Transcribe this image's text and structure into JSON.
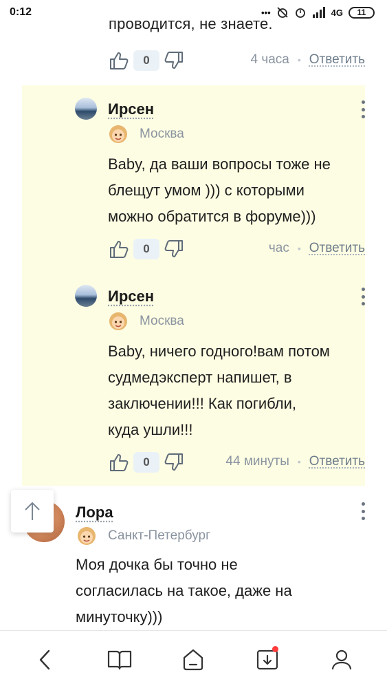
{
  "status_bar": {
    "time": "0:12",
    "network": "4G",
    "battery": "11"
  },
  "top_comment": {
    "partial_text": "проводится, не знаете.",
    "votes": "0",
    "time": "4 часа",
    "reply_label": "Ответить"
  },
  "replies": [
    {
      "author": "Ирсен",
      "city": "Москва",
      "lines": [
        "Baby, да ваши вопросы тоже не",
        "блещут умом ))) с которыми",
        "можно обратится в форуме)))"
      ],
      "votes": "0",
      "time": "час",
      "reply_label": "Ответить"
    },
    {
      "author": "Ирсен",
      "city": "Москва",
      "lines": [
        "Baby, ничего годного!вам потом",
        "судмедэксперт напишет, в",
        "заключении!!! Как погибли,",
        "куда ушли!!!"
      ],
      "votes": "0",
      "time": "44 минуты",
      "reply_label": "Ответить"
    }
  ],
  "lora_comment": {
    "author": "Лора",
    "city": "Санкт-Петербург",
    "lines": [
      "Моя дочка бы точно не",
      "согласилась на такое, даже на",
      "минуточку)))"
    ]
  },
  "nav": [
    "back-icon",
    "book-icon",
    "home-icon",
    "inbox-icon",
    "profile-icon"
  ],
  "colors": {
    "reply_bg": "#fdfde3",
    "vote_bg": "#eaf2f8",
    "meta": "#8a94a0",
    "notification": "#ff3b3b"
  }
}
